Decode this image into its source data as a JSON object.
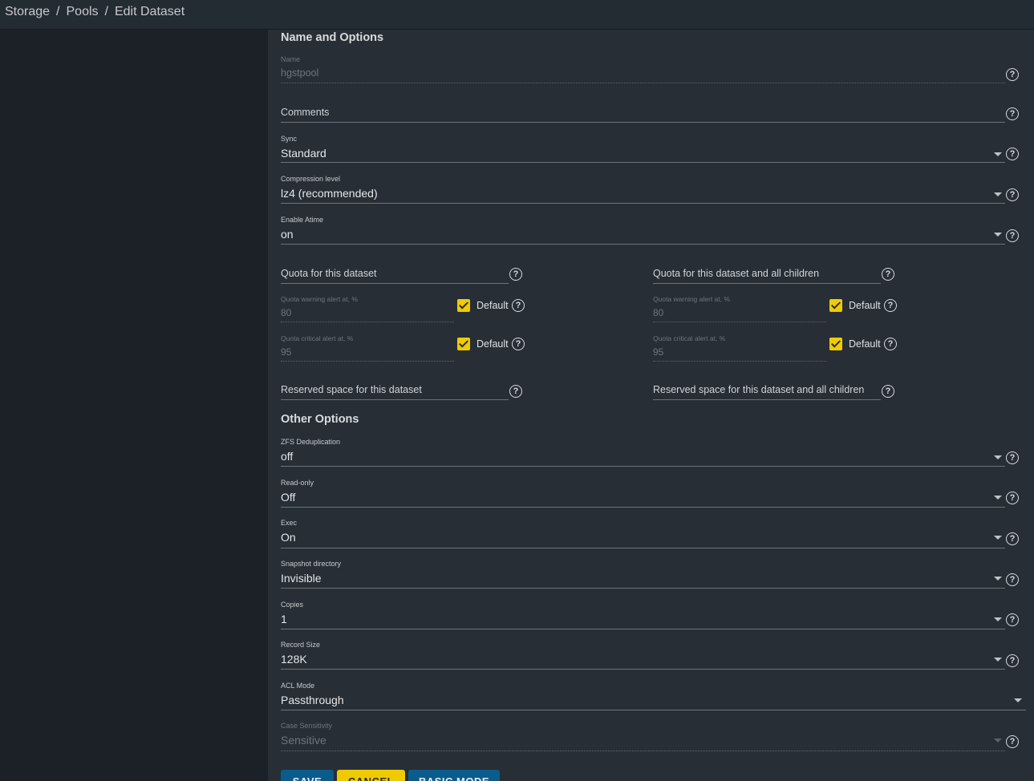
{
  "breadcrumb": [
    "Storage",
    "Pools",
    "Edit Dataset"
  ],
  "sections": {
    "name_options": "Name and Options",
    "other_options": "Other Options"
  },
  "fields": {
    "name": {
      "label": "Name",
      "value": "hgstpool"
    },
    "comments": {
      "placeholder": "Comments"
    },
    "sync": {
      "label": "Sync",
      "value": "Standard"
    },
    "compression": {
      "label": "Compression level",
      "value": "lz4 (recommended)"
    },
    "atime": {
      "label": "Enable Atime",
      "value": "on"
    },
    "quota_dataset": {
      "placeholder": "Quota for this dataset"
    },
    "quota_children": {
      "placeholder": "Quota for this dataset and all children"
    },
    "quota_warning_dataset": {
      "label": "Quota warning alert at, %",
      "value": "80",
      "default_label": "Default"
    },
    "quota_critical_dataset": {
      "label": "Quota critical alert at, %",
      "value": "95",
      "default_label": "Default"
    },
    "quota_warning_children": {
      "label": "Quota warning alert at, %",
      "value": "80",
      "default_label": "Default"
    },
    "quota_critical_children": {
      "label": "Quota critical alert at, %",
      "value": "95",
      "default_label": "Default"
    },
    "reserved_dataset": {
      "placeholder": "Reserved space for this dataset"
    },
    "reserved_children": {
      "placeholder": "Reserved space for this dataset and all children"
    },
    "dedup": {
      "label": "ZFS Deduplication",
      "value": "off"
    },
    "readonly": {
      "label": "Read-only",
      "value": "Off"
    },
    "exec": {
      "label": "Exec",
      "value": "On"
    },
    "snapdir": {
      "label": "Snapshot directory",
      "value": "Invisible"
    },
    "copies": {
      "label": "Copies",
      "value": "1"
    },
    "recordsize": {
      "label": "Record Size",
      "value": "128K"
    },
    "aclmode": {
      "label": "ACL Mode",
      "value": "Passthrough"
    },
    "casesensitivity": {
      "label": "Case Sensitivity",
      "value": "Sensitive"
    }
  },
  "buttons": {
    "save": "SAVE",
    "cancel": "CANCEL",
    "basic_mode": "BASIC MODE"
  },
  "help_glyph": "?",
  "colors": {
    "accent_yellow": "#efca00",
    "button_blue": "#0a5c8c"
  }
}
